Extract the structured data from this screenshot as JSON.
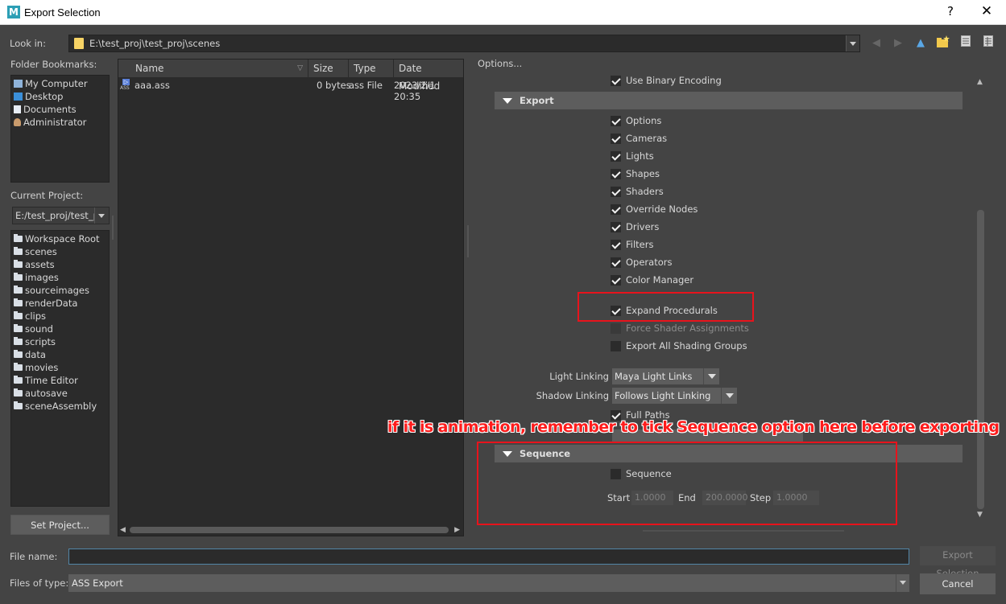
{
  "window": {
    "title": "Export Selection",
    "logo": "M",
    "help": "?",
    "close": "✕"
  },
  "lookin": {
    "label": "Look in:",
    "path": "E:\\test_proj\\test_proj\\scenes"
  },
  "bookmarks": {
    "label": "Folder Bookmarks:",
    "items": [
      "My Computer",
      "Desktop",
      "Documents",
      "Administrator"
    ]
  },
  "project": {
    "label": "Current Project:",
    "value": "E:/test_proj/test_proj",
    "folders": [
      "Workspace Root",
      "scenes",
      "assets",
      "images",
      "sourceimages",
      "renderData",
      "clips",
      "sound",
      "scripts",
      "data",
      "movies",
      "Time Editor",
      "autosave",
      "sceneAssembly"
    ],
    "set_button": "Set Project..."
  },
  "filelist": {
    "columns": [
      "Name",
      "Size",
      "Type",
      "Date Modified"
    ],
    "rows": [
      {
        "name": "aaa.ass",
        "size": "0 bytes",
        "type": "ass File",
        "date": "2023/2/1 20:35",
        "icon": "ASS"
      }
    ]
  },
  "options": {
    "label": "Options...",
    "binary_encoding": "Use Binary Encoding",
    "export_frame": "Export",
    "export_items": [
      "Options",
      "Cameras",
      "Lights",
      "Shapes",
      "Shaders",
      "Override Nodes",
      "Drivers",
      "Filters",
      "Operators",
      "Color Manager"
    ],
    "expand_procedurals": "Expand Procedurals",
    "force_shader": "Force Shader Assignments",
    "export_all_shading": "Export All Shading Groups",
    "light_linking_label": "Light Linking",
    "light_linking_value": "Maya Light Links",
    "shadow_linking_label": "Shadow Linking",
    "shadow_linking_value": "Follows Light Linking",
    "full_paths": "Full Paths",
    "sequence_frame": "Sequence",
    "sequence_cb": "Sequence",
    "start_label": "Start",
    "start_value": "1.0000",
    "end_label": "End",
    "end_value": "200.0000",
    "step_label": "Step",
    "step_value": "1.0000"
  },
  "annotation": "if it is animation, remember to tick Sequence option here before exporting",
  "bottom": {
    "filename_label": "File name:",
    "filename_value": "",
    "filetype_label": "Files of type:",
    "filetype_value": "ASS Export",
    "export_button": "Export Selection",
    "cancel_button": "Cancel"
  },
  "colors": {
    "annotation": "#e8131c",
    "accent": "#5285a6"
  }
}
